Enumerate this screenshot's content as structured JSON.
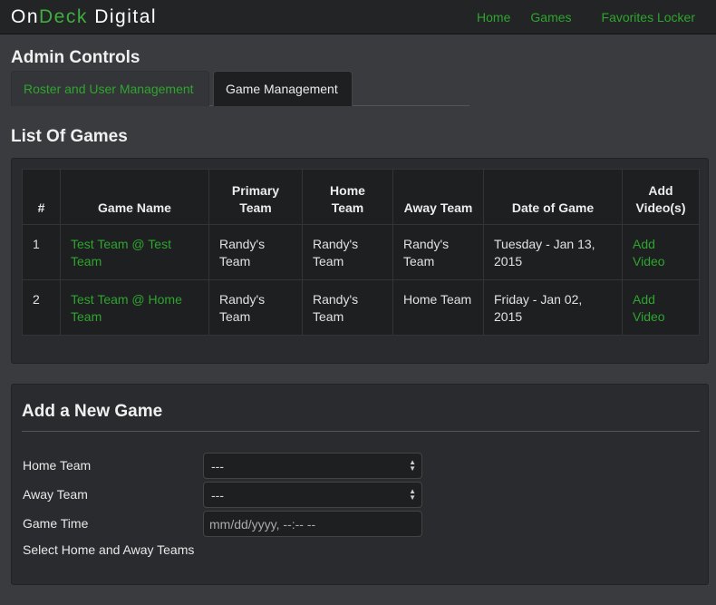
{
  "brand": {
    "part1": "On",
    "part2": "Deck",
    "part3": " Digital"
  },
  "nav": [
    "Home",
    "Games",
    "Favorites Locker"
  ],
  "admin_title": "Admin Controls",
  "tabs": [
    "Roster and User Management",
    "Game Management"
  ],
  "list_title": "List Of Games",
  "table": {
    "headers": [
      "#",
      "Game Name",
      "Primary Team",
      "Home Team",
      "Away Team",
      "Date of Game",
      "Add Video(s)"
    ],
    "rows": [
      {
        "num": "1",
        "name": "Test Team @ Test Team",
        "primary": "Randy's Team",
        "home": "Randy's Team",
        "away": "Randy's Team",
        "date": "Tuesday - Jan 13, 2015",
        "action": "Add Video"
      },
      {
        "num": "2",
        "name": "Test Team @ Home Team",
        "primary": "Randy's Team",
        "home": "Randy's Team",
        "away": "Home Team",
        "date": "Friday - Jan 02, 2015",
        "action": "Add Video"
      }
    ]
  },
  "add_form": {
    "title": "Add a New Game",
    "home_label": "Home Team",
    "home_value": "---",
    "away_label": "Away Team",
    "away_value": "---",
    "time_label": "Game Time",
    "time_placeholder": "mm/dd/yyyy, --:-- --",
    "hint": "Select Home and Away Teams"
  },
  "colors": {
    "accent": "#2ea52e",
    "background": "#3a3b3e",
    "panel": "#2a2b2e",
    "navbar": "#232426"
  }
}
